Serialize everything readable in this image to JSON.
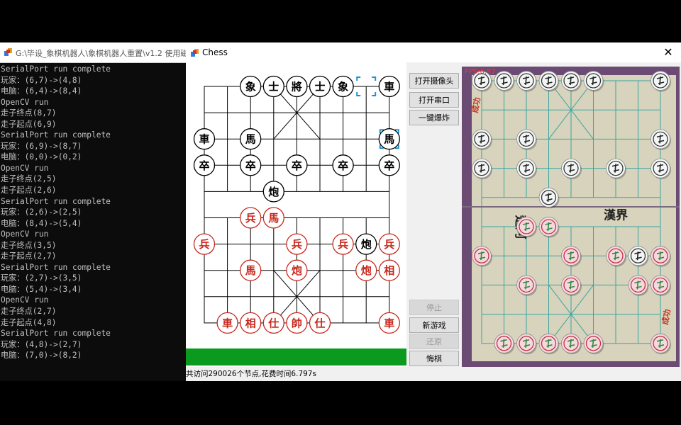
{
  "console": {
    "title": "G:\\毕设_象棋机器人\\象棋机器人重置\\v1.2 使用磁性象",
    "lines": [
      "SerialPort run complete",
      "玩家：(6,7)->(4,8)",
      "电脑：(6,4)->(8,4)",
      "OpenCV run",
      "走子终点(8,7)",
      "走子起点(6,9)",
      "SerialPort run complete",
      "玩家：(6,9)->(8,7)",
      "电脑：(0,0)->(0,2)",
      "OpenCV run",
      "走子终点(2,5)",
      "走子起点(2,6)",
      "SerialPort run complete",
      "玩家：(2,6)->(2,5)",
      "电脑：(8,4)->(5,4)",
      "OpenCV run",
      "走子终点(3,5)",
      "走子起点(2,7)",
      "SerialPort run complete",
      "玩家：(2,7)->(3,5)",
      "电脑：(5,4)->(3,4)",
      "OpenCV run",
      "走子终点(2,7)",
      "走子起点(4,8)",
      "SerialPort run complete",
      "玩家：(4,8)->(2,7)",
      "电脑：(7,0)->(8,2)"
    ]
  },
  "chess": {
    "title": "Chess",
    "close_icon": "close-icon",
    "status": "共访问290026个节点,花费时间6.797s",
    "progress_fraction": 1.0,
    "progress_color": "#0a9a1e",
    "buttons": [
      {
        "label": "打开摄像头",
        "enabled": true
      },
      {
        "label": "打开串口",
        "enabled": true
      },
      {
        "label": "一键爆炸",
        "enabled": true
      },
      {
        "label": "停止",
        "enabled": false
      },
      {
        "label": "新游戏",
        "enabled": true
      },
      {
        "label": "还原",
        "enabled": false
      },
      {
        "label": "悔棋",
        "enabled": true
      }
    ],
    "board": {
      "black_color": "#000000",
      "red_color": "#c8281e",
      "selection_color": "#1e90d0",
      "pieces": [
        {
          "t": "象",
          "c": "b",
          "f": 2,
          "r": 0
        },
        {
          "t": "士",
          "c": "b",
          "f": 3,
          "r": 0
        },
        {
          "t": "將",
          "c": "b",
          "f": 4,
          "r": 0
        },
        {
          "t": "士",
          "c": "b",
          "f": 5,
          "r": 0
        },
        {
          "t": "象",
          "c": "b",
          "f": 6,
          "r": 0
        },
        {
          "t": "車",
          "c": "b",
          "f": 8,
          "r": 0
        },
        {
          "t": "車",
          "c": "b",
          "f": 0,
          "r": 2
        },
        {
          "t": "馬",
          "c": "b",
          "f": 2,
          "r": 2
        },
        {
          "t": "馬",
          "c": "b",
          "f": 8,
          "r": 2
        },
        {
          "t": "卒",
          "c": "b",
          "f": 0,
          "r": 3
        },
        {
          "t": "卒",
          "c": "b",
          "f": 2,
          "r": 3
        },
        {
          "t": "卒",
          "c": "b",
          "f": 4,
          "r": 3
        },
        {
          "t": "卒",
          "c": "b",
          "f": 6,
          "r": 3
        },
        {
          "t": "卒",
          "c": "b",
          "f": 8,
          "r": 3
        },
        {
          "t": "炮",
          "c": "b",
          "f": 3,
          "r": 4
        },
        {
          "t": "兵",
          "c": "r",
          "f": 2,
          "r": 5
        },
        {
          "t": "馬",
          "c": "r",
          "f": 3,
          "r": 5
        },
        {
          "t": "兵",
          "c": "r",
          "f": 0,
          "r": 6
        },
        {
          "t": "兵",
          "c": "r",
          "f": 4,
          "r": 6
        },
        {
          "t": "兵",
          "c": "r",
          "f": 6,
          "r": 6
        },
        {
          "t": "炮",
          "c": "b",
          "f": 7,
          "r": 6
        },
        {
          "t": "兵",
          "c": "r",
          "f": 8,
          "r": 6
        },
        {
          "t": "馬",
          "c": "r",
          "f": 2,
          "r": 7
        },
        {
          "t": "炮",
          "c": "r",
          "f": 4,
          "r": 7
        },
        {
          "t": "炮",
          "c": "r",
          "f": 7,
          "r": 7
        },
        {
          "t": "相",
          "c": "r",
          "f": 8,
          "r": 7
        },
        {
          "t": "車",
          "c": "r",
          "f": 1,
          "r": 9
        },
        {
          "t": "相",
          "c": "r",
          "f": 2,
          "r": 9
        },
        {
          "t": "仕",
          "c": "r",
          "f": 3,
          "r": 9
        },
        {
          "t": "帥",
          "c": "r",
          "f": 4,
          "r": 9
        },
        {
          "t": "仕",
          "c": "r",
          "f": 5,
          "r": 9
        },
        {
          "t": "車",
          "c": "r",
          "f": 8,
          "r": 9
        }
      ],
      "selections": [
        {
          "f": 7,
          "r": 0
        },
        {
          "f": 8,
          "r": 2
        }
      ]
    },
    "camera": {
      "fps_label": "FPS:6.87",
      "board_color": "#d8d3bc",
      "frame_color": "#6b4b74",
      "river_left": "楚河",
      "river_right": "漢界",
      "corner_text": "成功",
      "pieces": [
        {
          "c": "w",
          "f": 0,
          "r": 0
        },
        {
          "c": "w",
          "f": 1,
          "r": 0
        },
        {
          "c": "w",
          "f": 2,
          "r": 0
        },
        {
          "c": "w",
          "f": 3,
          "r": 0
        },
        {
          "c": "w",
          "f": 4,
          "r": 0
        },
        {
          "c": "w",
          "f": 5,
          "r": 0
        },
        {
          "c": "w",
          "f": 8,
          "r": 0
        },
        {
          "c": "w",
          "f": 0,
          "r": 2
        },
        {
          "c": "w",
          "f": 2,
          "r": 2
        },
        {
          "c": "w",
          "f": 8,
          "r": 2
        },
        {
          "c": "w",
          "f": 0,
          "r": 3
        },
        {
          "c": "w",
          "f": 2,
          "r": 3
        },
        {
          "c": "w",
          "f": 4,
          "r": 3
        },
        {
          "c": "w",
          "f": 6,
          "r": 3
        },
        {
          "c": "w",
          "f": 8,
          "r": 3
        },
        {
          "c": "w",
          "f": 3,
          "r": 4
        },
        {
          "c": "r",
          "f": 2,
          "r": 5
        },
        {
          "c": "r",
          "f": 3,
          "r": 5
        },
        {
          "c": "r",
          "f": 0,
          "r": 6
        },
        {
          "c": "r",
          "f": 4,
          "r": 6
        },
        {
          "c": "r",
          "f": 6,
          "r": 6
        },
        {
          "c": "w",
          "f": 7,
          "r": 6
        },
        {
          "c": "r",
          "f": 8,
          "r": 6
        },
        {
          "c": "r",
          "f": 2,
          "r": 7
        },
        {
          "c": "r",
          "f": 4,
          "r": 7
        },
        {
          "c": "r",
          "f": 7,
          "r": 7
        },
        {
          "c": "r",
          "f": 8,
          "r": 7
        },
        {
          "c": "r",
          "f": 1,
          "r": 9
        },
        {
          "c": "r",
          "f": 2,
          "r": 9
        },
        {
          "c": "r",
          "f": 3,
          "r": 9
        },
        {
          "c": "r",
          "f": 4,
          "r": 9
        },
        {
          "c": "r",
          "f": 5,
          "r": 9
        },
        {
          "c": "r",
          "f": 8,
          "r": 9
        }
      ]
    }
  }
}
